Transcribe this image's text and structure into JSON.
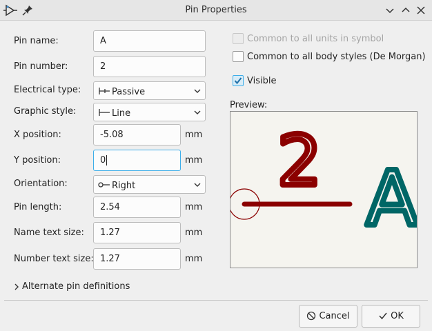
{
  "window": {
    "title": "Pin Properties"
  },
  "form": {
    "pin_name": {
      "label": "Pin name:",
      "value": "A"
    },
    "pin_number": {
      "label": "Pin number:",
      "value": "2"
    },
    "electrical_type": {
      "label": "Electrical type:",
      "value": "Passive"
    },
    "graphic_style": {
      "label": "Graphic style:",
      "value": "Line"
    },
    "x_position": {
      "label": "X position:",
      "value": "-5.08",
      "unit": "mm"
    },
    "y_position": {
      "label": "Y position:",
      "value": "0",
      "unit": "mm"
    },
    "orientation": {
      "label": "Orientation:",
      "value": "Right"
    },
    "pin_length": {
      "label": "Pin length:",
      "value": "2.54",
      "unit": "mm"
    },
    "name_text_size": {
      "label": "Name text size:",
      "value": "1.27",
      "unit": "mm"
    },
    "number_text_size": {
      "label": "Number text size:",
      "value": "1.27",
      "unit": "mm"
    }
  },
  "options": {
    "common_units": {
      "label": "Common to all units in symbol",
      "checked": false,
      "disabled": true
    },
    "common_body_styles": {
      "label": "Common to all body styles (De Morgan)",
      "checked": false
    },
    "visible": {
      "label": "Visible",
      "checked": true
    }
  },
  "preview": {
    "label": "Preview:",
    "pin_number": "2",
    "pin_name": "A",
    "colors": {
      "pin": "#8b0000",
      "name": "#006666",
      "background": "#f5f4ef"
    }
  },
  "alternate": {
    "label": "Alternate pin definitions"
  },
  "buttons": {
    "cancel": "Cancel",
    "ok": "OK"
  }
}
